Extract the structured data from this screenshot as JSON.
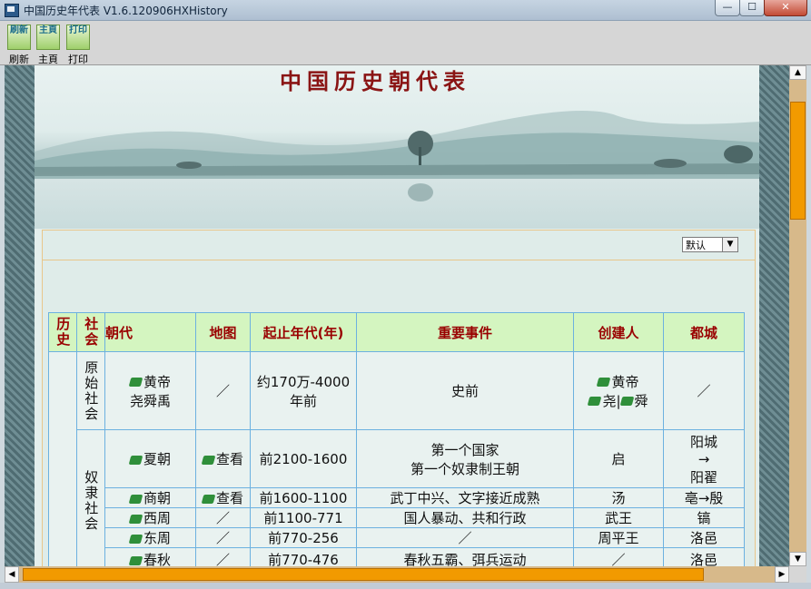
{
  "window": {
    "title": "中国历史年代表 V1.6.120906HXHistory",
    "minimize": "—",
    "maximize": "☐",
    "close": "✕"
  },
  "toolbar": {
    "items": [
      {
        "icon_text": "刷新",
        "label": "刷新"
      },
      {
        "icon_text": "主頁",
        "label": "主頁"
      },
      {
        "icon_text": "打印",
        "label": "打印"
      }
    ]
  },
  "banner": {
    "title": "中国历史朝代表"
  },
  "sort_select": {
    "value": "默认"
  },
  "table": {
    "headers": [
      "历史",
      "社会",
      "朝代",
      "地图",
      "起止年代(年)",
      "重要事件",
      "创建人",
      "都城"
    ],
    "society_primitive": "原始社会",
    "society_slave": "奴隶社会",
    "rows": [
      {
        "dynasty": "黄帝",
        "dynasty2": "尧舜禹",
        "map": "／",
        "years": "约170万-4000",
        "years2": "年前",
        "events": "史前",
        "events2": "",
        "founder": "黄帝",
        "founder2a": "尧",
        "founder2b": "舜",
        "capital": "／",
        "capital2": "",
        "capital3": ""
      },
      {
        "dynasty": "夏朝",
        "map": "查看",
        "years": "前2100-1600",
        "events": "第一个国家",
        "events2": "第一个奴隶制王朝",
        "founder": "启",
        "capital": "阳城",
        "capital2": "→",
        "capital3": "阳翟"
      },
      {
        "dynasty": "商朝",
        "map": "查看",
        "years": "前1600-1100",
        "events": "武丁中兴、文字接近成熟",
        "founder": "汤",
        "capital": "亳→殷"
      },
      {
        "dynasty": "西周",
        "map": "／",
        "years": "前1100-771",
        "events": "国人暴动、共和行政",
        "founder": "武王",
        "capital": "镐"
      },
      {
        "dynasty": "东周",
        "map": "／",
        "years": "前770-256",
        "events": "／",
        "founder": "周平王",
        "capital": "洛邑"
      },
      {
        "dynasty": "春秋",
        "map": "／",
        "years": "前770-476",
        "events": "春秋五霸、弭兵运动",
        "founder": "／",
        "capital": "洛邑"
      }
    ]
  },
  "scrollbars": {
    "up": "▲",
    "down": "▼",
    "left": "◀",
    "right": "▶"
  }
}
